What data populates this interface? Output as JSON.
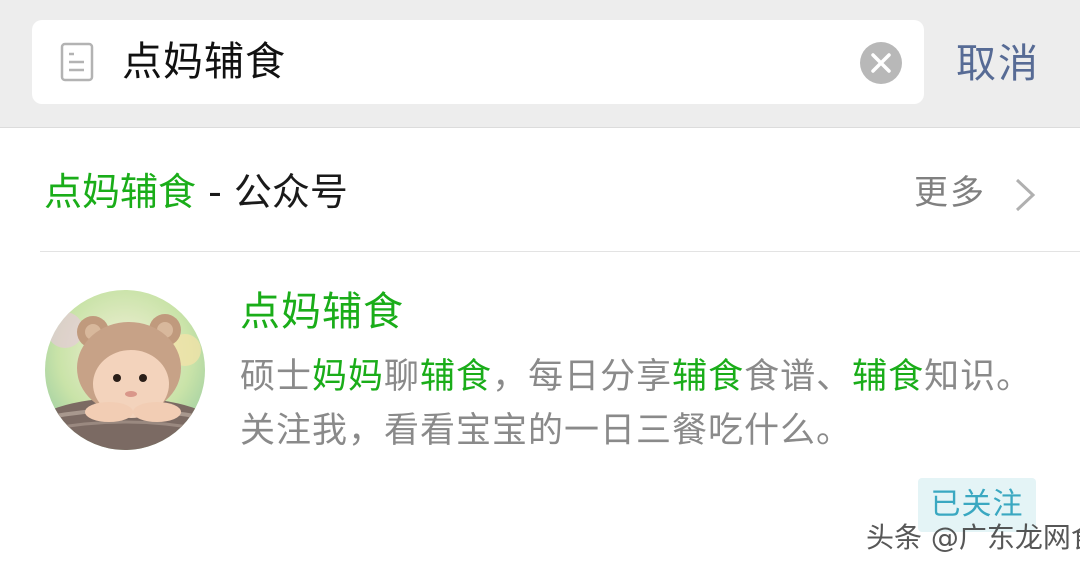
{
  "search": {
    "query": "点妈辅食",
    "cancel_label": "取消"
  },
  "section": {
    "name_highlight": "点妈辅食",
    "separator": " - ",
    "type_label": "公众号",
    "more_label": "更多"
  },
  "account": {
    "name": "点妈辅食",
    "description_parts": [
      "硕士",
      "妈妈",
      "聊",
      "辅食",
      "，每日分享",
      "辅食",
      "食谱、",
      "辅食",
      "知识。关注我，看看宝宝的一日三餐吃什么。"
    ],
    "follow_status": "已关注"
  },
  "watermark": "头条 @广东龙网食",
  "colors": {
    "accent_green": "#1aad19",
    "link_blue": "#576b95",
    "badge_bg": "#e4f4f6",
    "badge_text": "#3aa8c1"
  },
  "icons": [
    "document-icon",
    "clear-icon",
    "chevron-right-icon",
    "avatar"
  ]
}
